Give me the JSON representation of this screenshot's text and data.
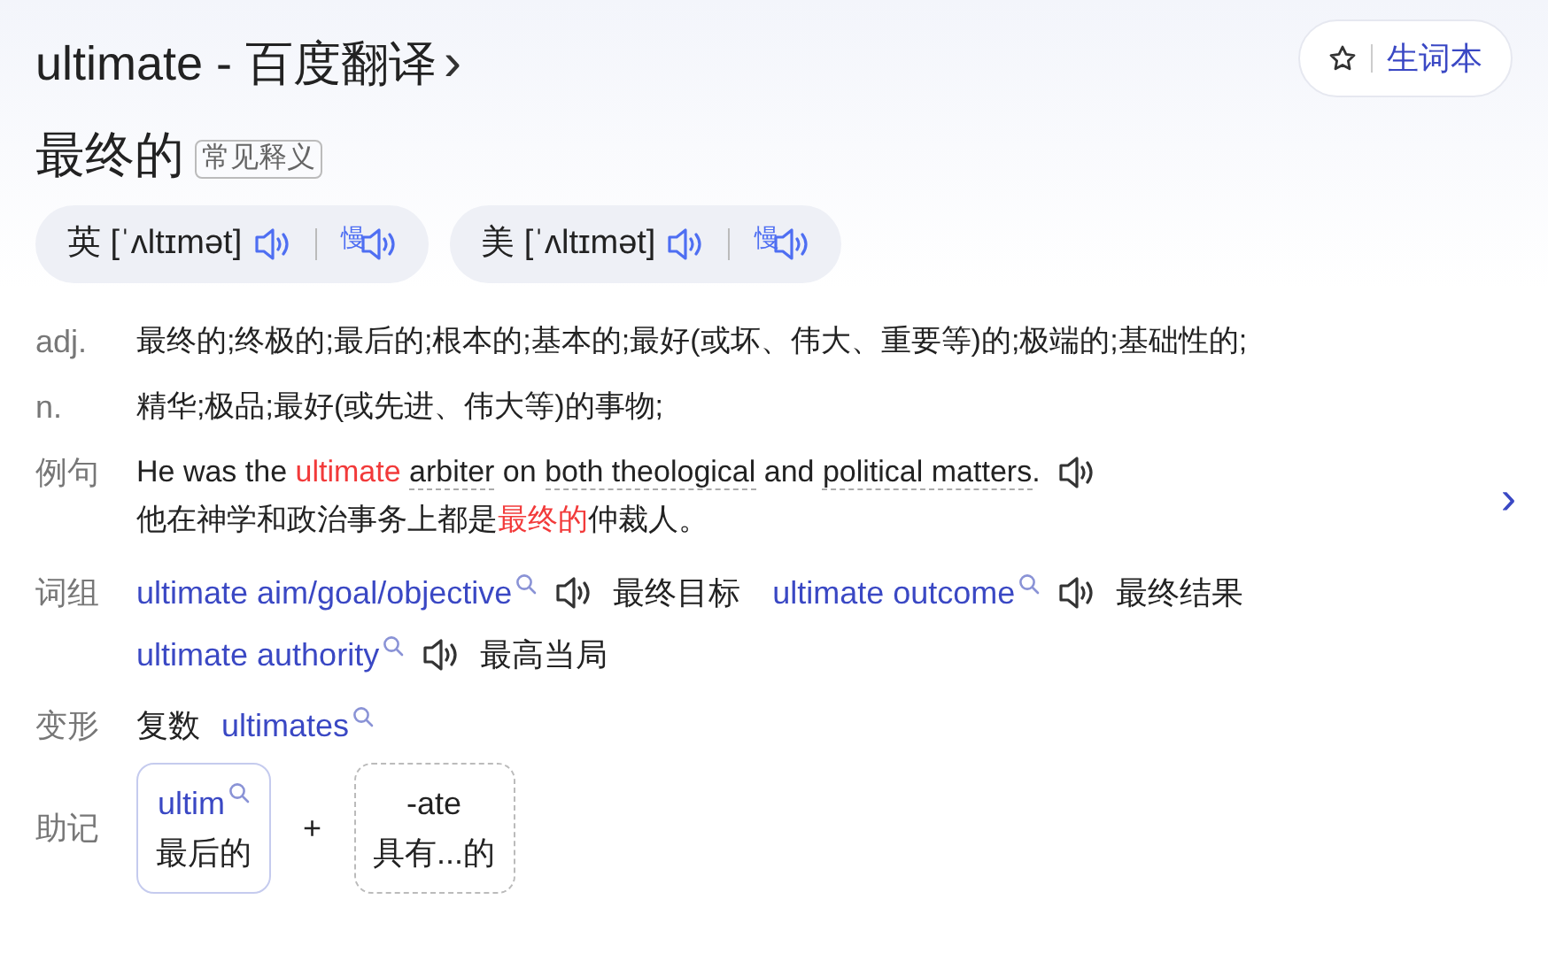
{
  "header": {
    "title": "ultimate - 百度翻译",
    "title_arrow": "›",
    "wordbook_button": "生词本"
  },
  "headword": "最终的",
  "headword_tag": "常见释义",
  "pronunciations": [
    {
      "region": "英",
      "ipa": "[ˈʌltɪmət]",
      "slow_label": "慢"
    },
    {
      "region": "美",
      "ipa": "[ˈʌltɪmət]",
      "slow_label": "慢"
    }
  ],
  "definitions": [
    {
      "pos": "adj.",
      "text": "最终的;终极的;最后的;根本的;基本的;最好(或坏、伟大、重要等)的;极端的;基础性的;"
    },
    {
      "pos": "n.",
      "text": "精华;极品;最好(或先进、伟大等)的事物;"
    }
  ],
  "example": {
    "label": "例句",
    "next_arrow": "›",
    "english": [
      {
        "text": "He was the ",
        "kind": "plain"
      },
      {
        "text": "ultimate ",
        "kind": "highlight"
      },
      {
        "text": "arbiter",
        "kind": "underlined"
      },
      {
        "text": " on ",
        "kind": "plain"
      },
      {
        "text": "both theological",
        "kind": "underlined"
      },
      {
        "text": " and ",
        "kind": "plain"
      },
      {
        "text": "political matters",
        "kind": "underlined"
      },
      {
        "text": ".",
        "kind": "plain"
      }
    ],
    "chinese": [
      {
        "text": "他在神学和政治事务上都是",
        "kind": "plain"
      },
      {
        "text": "最终的",
        "kind": "highlight"
      },
      {
        "text": "仲裁人。",
        "kind": "plain"
      }
    ]
  },
  "phrases": {
    "label": "词组",
    "lines": [
      [
        {
          "phrase": "ultimate aim/goal/objective",
          "meaning": "最终目标"
        },
        {
          "phrase": "ultimate outcome",
          "meaning": "最终结果"
        }
      ],
      [
        {
          "phrase": "ultimate authority",
          "meaning": "最高当局"
        }
      ]
    ]
  },
  "inflections": {
    "label": "变形",
    "type": "复数",
    "form": "ultimates"
  },
  "mnemonic": {
    "label": "助记",
    "plus": "+",
    "parts": [
      {
        "kind": "link",
        "root": "ultim",
        "meaning": "最后的"
      },
      {
        "kind": "suffix",
        "root": "-ate",
        "meaning": "具有...的"
      }
    ]
  }
}
